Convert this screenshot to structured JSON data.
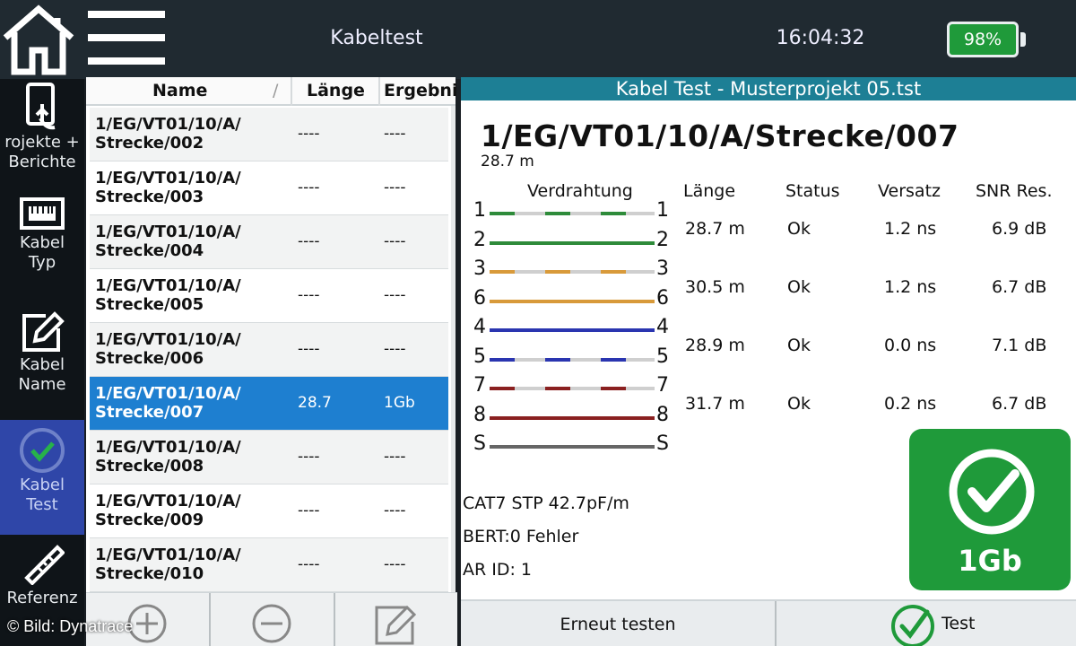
{
  "header": {
    "title": "Kabeltest",
    "time": "16:04:32",
    "battery": "98%"
  },
  "sidebar": {
    "items": [
      {
        "label": "rojekte +\nBerichte",
        "icon": "tablet-touch-icon"
      },
      {
        "label": "Kabel\nTyp",
        "icon": "rj45-port-icon"
      },
      {
        "label": "Kabel\nName",
        "icon": "edit-icon"
      },
      {
        "label": "Kabel\nTest",
        "icon": "check-circle-icon",
        "active": true
      },
      {
        "label": "Referenz",
        "icon": "ruler-icon"
      }
    ]
  },
  "list": {
    "columns": [
      "Name",
      "Länge",
      "Ergebni"
    ],
    "rows": [
      {
        "name": "1/EG/VT01/10/A/\nStrecke/002",
        "length": "----",
        "result": "----"
      },
      {
        "name": "1/EG/VT01/10/A/\nStrecke/003",
        "length": "----",
        "result": "----"
      },
      {
        "name": "1/EG/VT01/10/A/\nStrecke/004",
        "length": "----",
        "result": "----"
      },
      {
        "name": "1/EG/VT01/10/A/\nStrecke/005",
        "length": "----",
        "result": "----"
      },
      {
        "name": "1/EG/VT01/10/A/\nStrecke/006",
        "length": "----",
        "result": "----"
      },
      {
        "name": "1/EG/VT01/10/A/\nStrecke/007",
        "length": "28.7",
        "result": "1Gb",
        "selected": true
      },
      {
        "name": "1/EG/VT01/10/A/\nStrecke/008",
        "length": "----",
        "result": "----"
      },
      {
        "name": "1/EG/VT01/10/A/\nStrecke/009",
        "length": "----",
        "result": "----"
      },
      {
        "name": "1/EG/VT01/10/A/\nStrecke/010",
        "length": "----",
        "result": "----"
      }
    ]
  },
  "toolbar": {
    "add_icon": "plus-circle-icon",
    "remove_icon": "minus-circle-icon",
    "edit_icon": "edit-icon"
  },
  "detail": {
    "title": "Kabel Test - Musterprojekt 05.tst",
    "cable_name": "1/EG/VT01/10/A/Strecke/007",
    "cable_length": "28.7 m",
    "columns": {
      "wiring": "Verdrahtung",
      "length": "Länge",
      "status": "Status",
      "skew": "Versatz",
      "snr": "SNR Res."
    },
    "pins": [
      {
        "left": "1",
        "right": "1",
        "color": "#2e8b3a",
        "striped": true
      },
      {
        "left": "2",
        "right": "2",
        "color": "#2e8b3a",
        "striped": false
      },
      {
        "left": "3",
        "right": "3",
        "color": "#d89a3a",
        "striped": true
      },
      {
        "left": "6",
        "right": "6",
        "color": "#d89a3a",
        "striped": false
      },
      {
        "left": "4",
        "right": "4",
        "color": "#2a35b0",
        "striped": false
      },
      {
        "left": "5",
        "right": "5",
        "color": "#2a35b0",
        "striped": true
      },
      {
        "left": "7",
        "right": "7",
        "color": "#8a2020",
        "striped": true
      },
      {
        "left": "8",
        "right": "8",
        "color": "#8a2020",
        "striped": false
      },
      {
        "left": "S",
        "right": "S",
        "color": "#666666",
        "striped": false
      }
    ],
    "pairs": [
      {
        "length": "28.7 m",
        "status": "Ok",
        "skew": "1.2 ns",
        "snr": "6.9 dB"
      },
      {
        "length": "30.5 m",
        "status": "Ok",
        "skew": "1.2 ns",
        "snr": "6.7 dB"
      },
      {
        "length": "28.9 m",
        "status": "Ok",
        "skew": "0.0 ns",
        "snr": "7.1 dB"
      },
      {
        "length": "31.7 m",
        "status": "Ok",
        "skew": "0.2 ns",
        "snr": "6.7 dB"
      }
    ],
    "cable_type": "CAT7 STP  42.7pF/m",
    "bert": "BERT:0 Fehler",
    "ar_id": "AR ID: 1",
    "result": "1Gb"
  },
  "actions": {
    "retest": "Erneut testen",
    "test": "Test"
  },
  "watermark": "© Bild: Dynatrace",
  "colors": {
    "accent_blue": "#1e7fd0",
    "teal_header": "#1d7f95",
    "success_green": "#1f9a3a",
    "sidebar_active": "#2f46a8"
  }
}
